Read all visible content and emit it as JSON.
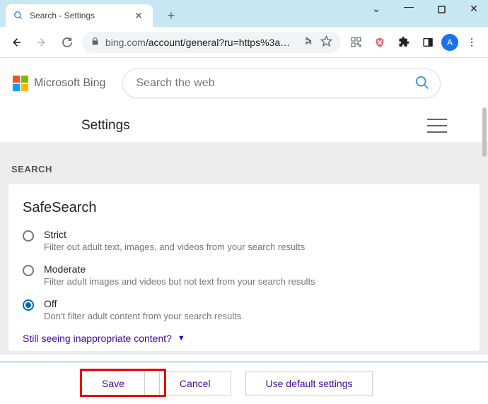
{
  "browser": {
    "tab_title": "Search - Settings",
    "url_display": "bing.com/account/general?ru=https%3a%2f…",
    "avatar_letter": "A"
  },
  "bing": {
    "logo_text": "Microsoft Bing",
    "search_placeholder": "Search the web"
  },
  "settings": {
    "page_title": "Settings",
    "section_label": "SEARCH",
    "card_title": "SafeSearch",
    "options": [
      {
        "label": "Strict",
        "desc": "Filter out adult text, images, and videos from your search results",
        "selected": false
      },
      {
        "label": "Moderate",
        "desc": "Filter adult images and videos but not text from your search results",
        "selected": false
      },
      {
        "label": "Off",
        "desc": "Don't filter adult content from your search results",
        "selected": true
      }
    ],
    "inappropriate_link": "Still seeing inappropriate content?"
  },
  "footer": {
    "save": "Save",
    "cancel": "Cancel",
    "defaults": "Use default settings"
  }
}
